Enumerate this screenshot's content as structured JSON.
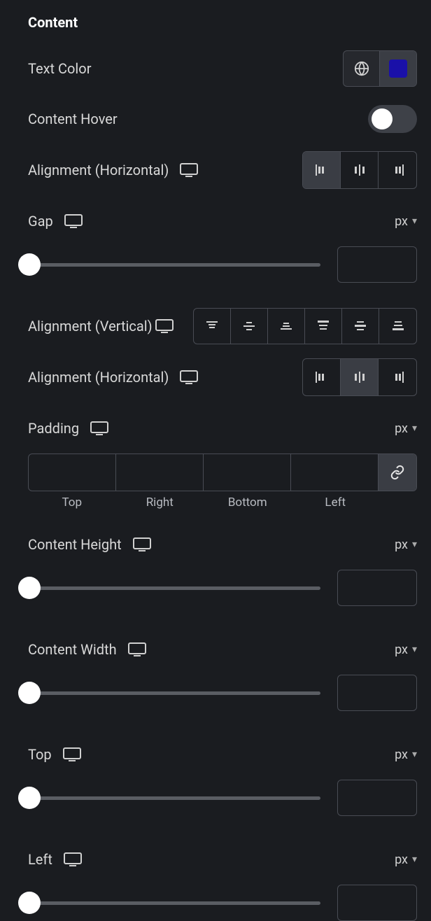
{
  "section": {
    "title": "Content"
  },
  "text_color": {
    "label": "Text Color",
    "swatch_hex": "#1a10a8"
  },
  "content_hover": {
    "label": "Content Hover",
    "enabled": false
  },
  "h_align_1": {
    "label": "Alignment (Horizontal)",
    "options": [
      "left",
      "center",
      "right"
    ],
    "active_index": 0
  },
  "gap": {
    "label": "Gap",
    "unit": "px",
    "value": ""
  },
  "v_align": {
    "label": "Alignment (Vertical)",
    "options": [
      "top",
      "middle",
      "bottom",
      "stretch-top",
      "stretch-mid",
      "stretch-bot"
    ],
    "active_index": null
  },
  "h_align_2": {
    "label": "Alignment (Horizontal)",
    "options": [
      "left",
      "center",
      "right"
    ],
    "active_index": 1
  },
  "padding": {
    "label": "Padding",
    "unit": "px",
    "top": "",
    "right": "",
    "bottom": "",
    "left": "",
    "labels": {
      "top": "Top",
      "right": "Right",
      "bottom": "Bottom",
      "left": "Left"
    }
  },
  "content_height": {
    "label": "Content Height",
    "unit": "px",
    "value": ""
  },
  "content_width": {
    "label": "Content Width",
    "unit": "px",
    "value": ""
  },
  "top": {
    "label": "Top",
    "unit": "px",
    "value": ""
  },
  "left": {
    "label": "Left",
    "unit": "px",
    "value": ""
  }
}
